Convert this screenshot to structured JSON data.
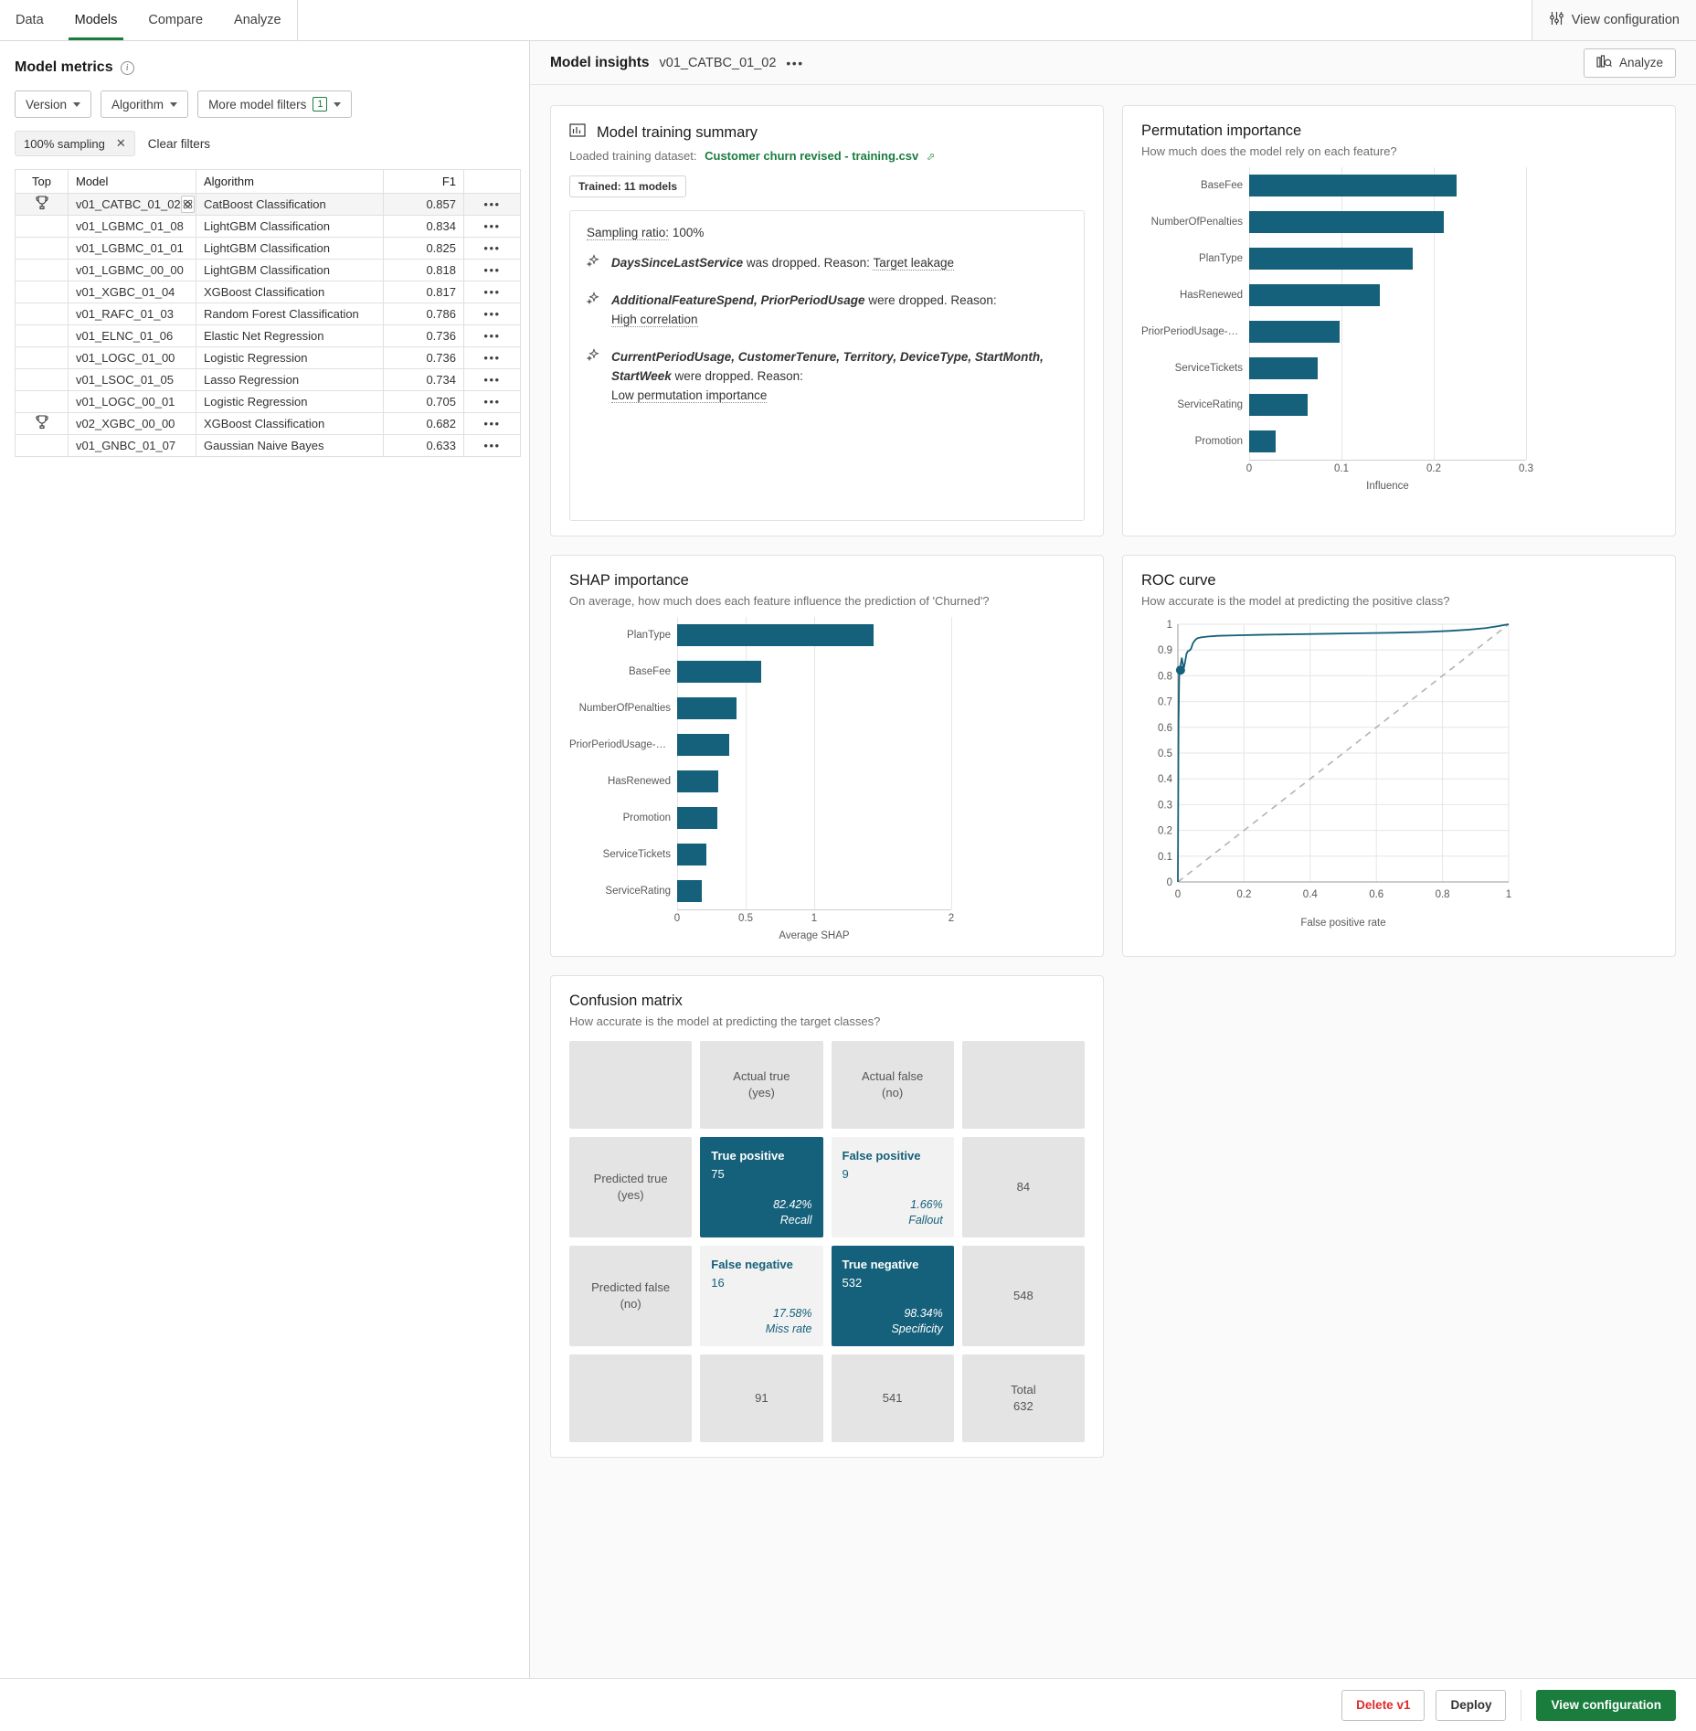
{
  "topnav": {
    "tabs": [
      {
        "label": "Data",
        "active": false
      },
      {
        "label": "Models",
        "active": true
      },
      {
        "label": "Compare",
        "active": false
      },
      {
        "label": "Analyze",
        "active": false
      }
    ],
    "view_configuration_label": "View configuration",
    "view_configuration_icon": "sliders-icon"
  },
  "left_panel": {
    "title": "Model metrics",
    "info_icon": "info-icon",
    "filters": [
      {
        "label": "Version",
        "icon": "chevron-down-icon"
      },
      {
        "label": "Algorithm",
        "icon": "chevron-down-icon"
      },
      {
        "label": "More model filters",
        "badge": "1",
        "icon": "chevron-down-icon"
      }
    ],
    "active_chip": {
      "label": "100% sampling",
      "remove_icon": "close-icon"
    },
    "clear_filters_label": "Clear filters",
    "table": {
      "columns": [
        "Top",
        "Model",
        "Algorithm",
        "F1",
        ""
      ],
      "rows": [
        {
          "top": "trophy-icon",
          "model": "v01_CATBC_01_02",
          "algorithm": "CatBoost Classification",
          "f1": "0.857",
          "actions": "•••",
          "selected": true,
          "model_icon": "model-insights-icon"
        },
        {
          "top": "",
          "model": "v01_LGBMC_01_08",
          "algorithm": "LightGBM Classification",
          "f1": "0.834",
          "actions": "•••",
          "selected": false
        },
        {
          "top": "",
          "model": "v01_LGBMC_01_01",
          "algorithm": "LightGBM Classification",
          "f1": "0.825",
          "actions": "•••",
          "selected": false
        },
        {
          "top": "",
          "model": "v01_LGBMC_00_00",
          "algorithm": "LightGBM Classification",
          "f1": "0.818",
          "actions": "•••",
          "selected": false
        },
        {
          "top": "",
          "model": "v01_XGBC_01_04",
          "algorithm": "XGBoost Classification",
          "f1": "0.817",
          "actions": "•••",
          "selected": false
        },
        {
          "top": "",
          "model": "v01_RAFC_01_03",
          "algorithm": "Random Forest Classification",
          "f1": "0.786",
          "actions": "•••",
          "selected": false
        },
        {
          "top": "",
          "model": "v01_ELNC_01_06",
          "algorithm": "Elastic Net Regression",
          "f1": "0.736",
          "actions": "•••",
          "selected": false
        },
        {
          "top": "",
          "model": "v01_LOGC_01_00",
          "algorithm": "Logistic Regression",
          "f1": "0.736",
          "actions": "•••",
          "selected": false
        },
        {
          "top": "",
          "model": "v01_LSOC_01_05",
          "algorithm": "Lasso Regression",
          "f1": "0.734",
          "actions": "•••",
          "selected": false
        },
        {
          "top": "",
          "model": "v01_LOGC_00_01",
          "algorithm": "Logistic Regression",
          "f1": "0.705",
          "actions": "•••",
          "selected": false
        },
        {
          "top": "trophy-icon",
          "model": "v02_XGBC_00_00",
          "algorithm": "XGBoost Classification",
          "f1": "0.682",
          "actions": "•••",
          "selected": false
        },
        {
          "top": "",
          "model": "v01_GNBC_01_07",
          "algorithm": "Gaussian Naive Bayes",
          "f1": "0.633",
          "actions": "•••",
          "selected": false
        }
      ]
    }
  },
  "insights_header": {
    "title": "Model insights",
    "model_name": "v01_CATBC_01_02",
    "overflow": "•••",
    "analyze_label": "Analyze",
    "analyze_icon": "analyze-chart-icon"
  },
  "training_summary": {
    "icon": "chart-report-icon",
    "title": "Model training summary",
    "dataset_prefix": "Loaded training dataset:",
    "dataset_name": "Customer churn revised - training.csv",
    "external_link_icon": "external-link-icon",
    "trained_badge": "Trained: 11 models",
    "sampling_label": "Sampling ratio:",
    "sampling_value": "100%",
    "bullets": [
      {
        "icon": "sparkle-icon",
        "features": "DaysSinceLastService",
        "text": " was dropped. Reason: ",
        "reason": "Target leakage"
      },
      {
        "icon": "sparkle-icon",
        "features": "AdditionalFeatureSpend, PriorPeriodUsage",
        "text": " were dropped. Reason:",
        "reason": "High correlation"
      },
      {
        "icon": "sparkle-icon",
        "features": "CurrentPeriodUsage, CustomerTenure, Territory, DeviceType, StartMonth, StartWeek",
        "text": " were dropped. Reason:",
        "reason": "Low permutation importance"
      }
    ]
  },
  "colors": {
    "teal": "#15607a",
    "green": "#1a7d3e",
    "danger": "#e02b2b",
    "grid": "#e6e6e6"
  },
  "chart_data": [
    {
      "id": "permutation_importance",
      "type": "bar",
      "orientation": "horizontal",
      "title": "Permutation importance",
      "subtitle": "How much does the model rely on each feature?",
      "xlabel": "Influence",
      "ylabel": "",
      "xlim": [
        0,
        0.3
      ],
      "xticks": [
        "0",
        "0.1",
        "0.2",
        "0.3"
      ],
      "grid": true,
      "categories": [
        "BaseFee",
        "NumberOfPenalties",
        "PlanType",
        "HasRenewed",
        "PriorPeriodUsage-Rou...",
        "ServiceTickets",
        "ServiceRating",
        "Promotion"
      ],
      "values": [
        0.225,
        0.211,
        0.177,
        0.142,
        0.098,
        0.074,
        0.063,
        0.029
      ]
    },
    {
      "id": "shap_importance",
      "type": "bar",
      "orientation": "horizontal",
      "title": "SHAP importance",
      "subtitle": "On average, how much does each feature influence the prediction of 'Churned'?",
      "xlabel": "Average SHAP",
      "ylabel": "",
      "xlim": [
        0,
        2
      ],
      "xticks": [
        "0",
        "0.5",
        "1",
        "2"
      ],
      "grid": true,
      "categories": [
        "PlanType",
        "BaseFee",
        "NumberOfPenalties",
        "PriorPeriodUsage-Rou...",
        "HasRenewed",
        "Promotion",
        "ServiceTickets",
        "ServiceRating"
      ],
      "values": [
        1.43,
        0.61,
        0.43,
        0.38,
        0.3,
        0.29,
        0.21,
        0.18
      ]
    },
    {
      "id": "roc_curve",
      "type": "line",
      "title": "ROC curve",
      "subtitle": "How accurate is the model at predicting the positive class?",
      "xlabel": "False positive rate",
      "ylabel": "",
      "xlim": [
        0,
        1
      ],
      "ylim": [
        0,
        1
      ],
      "xticks": [
        "0",
        "0.2",
        "0.4",
        "0.6",
        "0.8",
        "1"
      ],
      "yticks": [
        "0",
        "0.1",
        "0.2",
        "0.3",
        "0.4",
        "0.5",
        "0.6",
        "0.7",
        "0.8",
        "0.9",
        "1"
      ],
      "grid": true,
      "series": [
        {
          "name": "ROC",
          "x": [
            0,
            0.002,
            0.004,
            0.006,
            0.008,
            0.012,
            0.015,
            0.018,
            0.022,
            0.026,
            0.03,
            0.035,
            0.04,
            0.045,
            0.05,
            0.055,
            0.06,
            0.07,
            0.09,
            0.12,
            0.18,
            0.25,
            0.35,
            0.45,
            0.55,
            0.65,
            0.75,
            0.82,
            0.88,
            0.93,
            0.97,
            1
          ],
          "y": [
            0,
            0.62,
            0.8,
            0.825,
            0.84,
            0.87,
            0.845,
            0.83,
            0.855,
            0.885,
            0.895,
            0.898,
            0.905,
            0.925,
            0.935,
            0.942,
            0.946,
            0.949,
            0.952,
            0.955,
            0.957,
            0.959,
            0.961,
            0.963,
            0.965,
            0.967,
            0.97,
            0.974,
            0.979,
            0.985,
            0.993,
            1
          ]
        },
        {
          "name": "Baseline",
          "x": [
            0,
            1
          ],
          "y": [
            0,
            1
          ],
          "style": "dashed"
        }
      ],
      "marker": {
        "x": 0.008,
        "y": 0.822
      }
    },
    {
      "id": "confusion_matrix",
      "type": "table",
      "title": "Confusion matrix",
      "subtitle": "How accurate is the model at predicting the target classes?",
      "col_headers": [
        "",
        "Actual true\n(yes)",
        "Actual false\n(no)",
        ""
      ],
      "rows": [
        {
          "row_label": "Predicted true\n(yes)",
          "cells": [
            {
              "name": "True positive",
              "value": "75",
              "pct": "82.42%",
              "pct_label": "Recall",
              "style": "filled"
            },
            {
              "name": "False positive",
              "value": "9",
              "pct": "1.66%",
              "pct_label": "Fallout",
              "style": "light"
            }
          ],
          "total": "84"
        },
        {
          "row_label": "Predicted false\n(no)",
          "cells": [
            {
              "name": "False negative",
              "value": "16",
              "pct": "17.58%",
              "pct_label": "Miss rate",
              "style": "light"
            },
            {
              "name": "True negative",
              "value": "532",
              "pct": "98.34%",
              "pct_label": "Specificity",
              "style": "filled"
            }
          ],
          "total": "548"
        }
      ],
      "footer": {
        "col1": "91",
        "col2": "541",
        "total_label": "Total",
        "total_value": "632"
      }
    }
  ],
  "footer": {
    "delete_label": "Delete v1",
    "deploy_label": "Deploy",
    "view_configuration_label": "View configuration"
  }
}
